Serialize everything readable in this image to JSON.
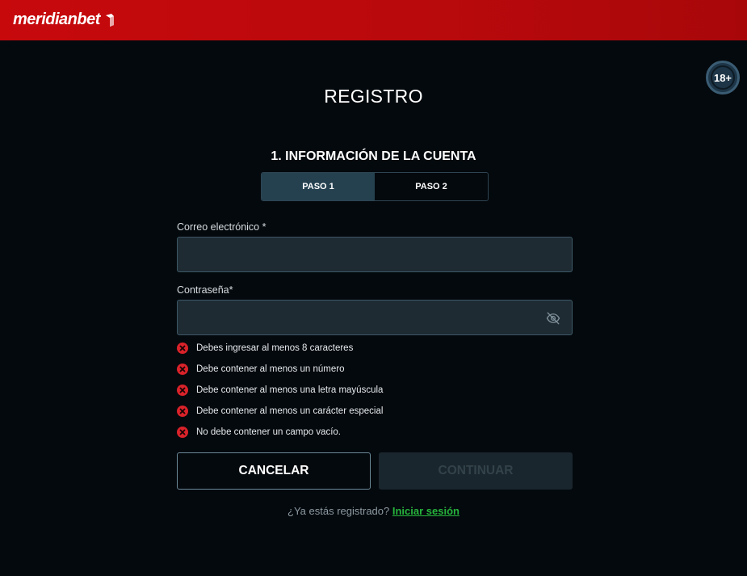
{
  "header": {
    "logo_text": "meridianbet",
    "colors": {
      "brand": "#c7090c"
    }
  },
  "age_badge": {
    "label": "18+"
  },
  "page": {
    "title": "REGISTRO",
    "section_title": "1. INFORMACIÓN DE LA CUENTA"
  },
  "steps": [
    {
      "label": "PASO 1",
      "active": true
    },
    {
      "label": "PASO 2",
      "active": false
    }
  ],
  "form": {
    "email": {
      "label": "Correo electrónico *",
      "value": "",
      "placeholder": ""
    },
    "password": {
      "label": "Contraseña*",
      "value": "",
      "placeholder": "",
      "toggle_icon": "eye-off-icon"
    }
  },
  "password_rules": [
    {
      "text": "Debes ingresar al menos 8 caracteres",
      "status": "error"
    },
    {
      "text": "Debe contener al menos un número",
      "status": "error"
    },
    {
      "text": "Debe contener al menos una letra mayúscula",
      "status": "error"
    },
    {
      "text": "Debe contener al menos un carácter especial",
      "status": "error"
    },
    {
      "text": "No debe contener un campo vacío.",
      "status": "error"
    }
  ],
  "buttons": {
    "cancel_label": "CANCELAR",
    "continue_label": "CONTINUAR"
  },
  "login": {
    "prompt": "¿Ya estás registrado?",
    "link_label": "Iniciar sesión",
    "link_color": "#26b43c"
  }
}
